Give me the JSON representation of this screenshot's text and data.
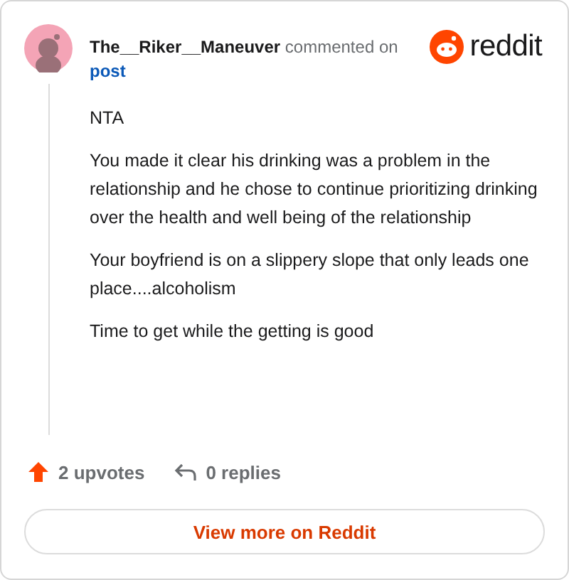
{
  "author": {
    "username": "The__Riker__Maneuver",
    "action": "commented on",
    "target": "post"
  },
  "logo": {
    "text": "reddit"
  },
  "comment": {
    "paragraphs": [
      "NTA",
      "You made it clear his drinking was a problem in the relationship and he chose to continue prioritizing drinking over the health and well being of the relationship",
      "Your boyfriend is on a slippery slope that only leads one place....alcoholism",
      "Time to get while the getting is good"
    ]
  },
  "stats": {
    "upvotes": "2 upvotes",
    "replies": "0 replies"
  },
  "button": {
    "label": "View more on Reddit"
  }
}
